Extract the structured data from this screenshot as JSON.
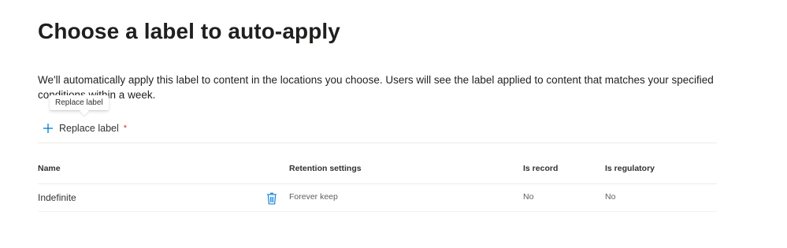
{
  "header": {
    "title": "Choose a label to auto-apply"
  },
  "description": "We'll automatically apply this label to content in the locations you choose. Users will see the label applied to content that matches your specified conditions within a week.",
  "tooltip": {
    "text": "Replace label"
  },
  "replace_button": {
    "label": "Replace label",
    "icon": "plus-icon",
    "required_marker": "*",
    "accent_color": "#0078d4"
  },
  "table": {
    "columns": [
      "Name",
      "Retention settings",
      "Is record",
      "Is regulatory"
    ],
    "rows": [
      {
        "name": "Indefinite",
        "delete_icon": "trash-icon",
        "retention": "Forever keep",
        "is_record": "No",
        "is_regulatory": "No"
      }
    ]
  }
}
